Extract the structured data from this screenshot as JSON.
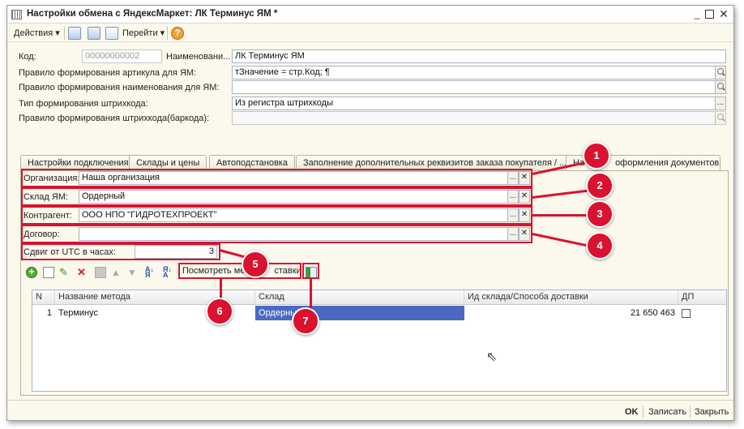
{
  "window": {
    "title": "Настройки обмена с ЯндексМаркет: ЛК Терминус ЯМ *"
  },
  "toolbar": {
    "actions": "Действия",
    "goto": "Перейти",
    "help": "?"
  },
  "form": {
    "code_label": "Код:",
    "code_value": "00000000002",
    "name_label": "Наименовани...",
    "name_value": "ЛК Терминус ЯМ",
    "article_rule_label": "Правило формирования артикула для ЯМ:",
    "article_rule_value": "тЗначение =  стр.Код; ¶",
    "name_rule_label": "Правило формирования наименования для ЯМ:",
    "name_rule_value": "",
    "barcode_type_label": "Тип формирования штрихкода:",
    "barcode_type_value": "Из регистра штрихкоды",
    "barcode_rule_label": "Правило формирования штрихкода(баркода):",
    "barcode_rule_value": ""
  },
  "tabs": [
    {
      "label": "Настройки подключения"
    },
    {
      "label": "Склады и цены"
    },
    {
      "label": "Автоподстановка"
    },
    {
      "label": "Заполнение дополнительных реквизитов заказа покупателя / ..."
    },
    {
      "label": "На",
      "label_tail": "оформления документов"
    }
  ],
  "panel": {
    "org_label": "Организация:",
    "org_value": "Наша организация",
    "warehouse_label": "Склад ЯМ:",
    "warehouse_value": "Ордерный",
    "contractor_label": "Контрагент:",
    "contractor_value": "ООО НПО \"ГИДРОТЕХПРОЕКТ\"",
    "contract_label": "Договор:",
    "contract_value": "",
    "utc_label": "Сдвиг от UTC в часах:",
    "utc_value": "3",
    "view_methods_prefix": "Посмотреть ме",
    "view_methods_suffix": "ставки"
  },
  "grid": {
    "headers": [
      "N",
      "Название метода",
      "Склад",
      "Ид склада/Способа доставки",
      "ДП"
    ],
    "rows": [
      {
        "n": "1",
        "method": "Терминус",
        "warehouse": "Ордерный",
        "id": "21 650 463",
        "dp": false
      }
    ]
  },
  "badges": [
    "1",
    "2",
    "3",
    "4",
    "5",
    "6",
    "7"
  ],
  "bottom": {
    "ok": "OK",
    "save": "Записать",
    "close": "Закрыть"
  },
  "colors": {
    "highlight": "#d9122f",
    "selection": "#4a6ac2"
  }
}
